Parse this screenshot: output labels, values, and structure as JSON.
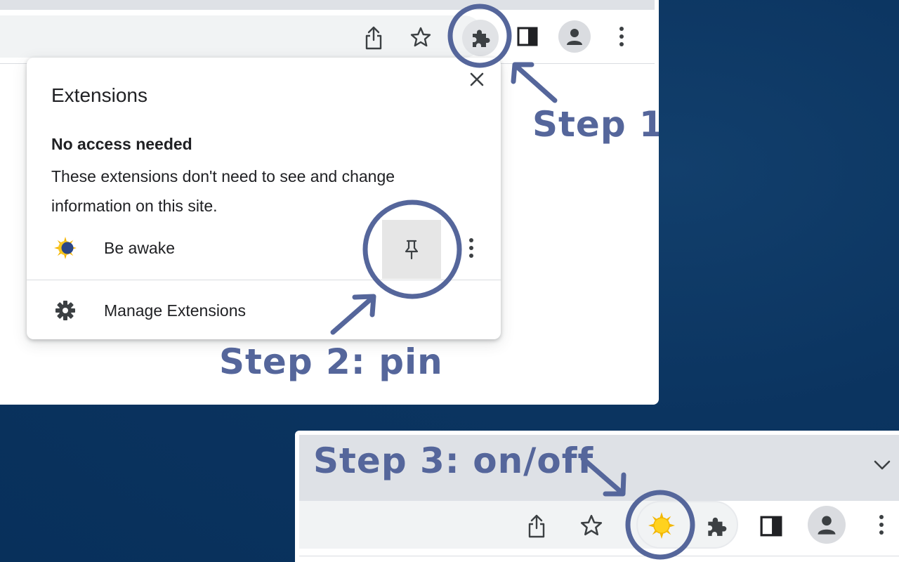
{
  "popup": {
    "title": "Extensions",
    "section_title": "No access needed",
    "section_desc": "These extensions don't need to see and change information on this site.",
    "extension_name": "Be awake",
    "manage_label": "Manage Extensions"
  },
  "steps": {
    "step1": "Step 1",
    "step2": "Step 2: pin",
    "step3": "Step 3: on/off"
  },
  "icons": {
    "window1_toolbar": [
      "share-icon",
      "star-icon",
      "extensions-puzzle-icon",
      "side-panel-icon",
      "profile-avatar-icon",
      "more-menu-icon"
    ],
    "window2_toolbar": [
      "share-icon",
      "star-icon",
      "be-awake-sun-icon",
      "extensions-puzzle-icon",
      "side-panel-icon",
      "profile-avatar-icon",
      "more-menu-icon"
    ],
    "tab_search": "chevron-down-icon"
  },
  "colors": {
    "background": "#0b3460",
    "annotation": "#55669b",
    "toolbar_bg": "#f1f3f4",
    "tabstrip_bg": "#dee1e6",
    "icon_dark": "#5f6368"
  }
}
